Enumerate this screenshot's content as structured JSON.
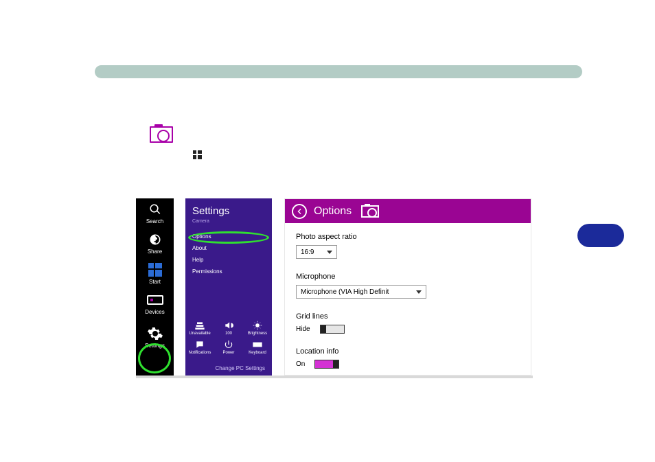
{
  "charms": {
    "search": "Search",
    "share": "Share",
    "start": "Start",
    "devices": "Devices",
    "settings": "Settings"
  },
  "settings_pane": {
    "title": "Settings",
    "subtitle": "Camera",
    "links": {
      "options": "Options",
      "about": "About",
      "help": "Help",
      "permissions": "Permissions"
    },
    "grid": {
      "unavailable": "Unavailable",
      "vol": "100",
      "brightness": "Brightness",
      "notifications": "Notifications",
      "power": "Power",
      "keyboard": "Keyboard"
    },
    "change_pc": "Change PC Settings"
  },
  "options": {
    "header": "Options",
    "aspect": {
      "label": "Photo aspect ratio",
      "value": "16:9"
    },
    "mic": {
      "label": "Microphone",
      "value": "Microphone (VIA High Definit"
    },
    "grid": {
      "label": "Grid lines",
      "state_text": "Hide",
      "on": false
    },
    "location": {
      "label": "Location info",
      "state_text": "On",
      "on": true
    }
  }
}
